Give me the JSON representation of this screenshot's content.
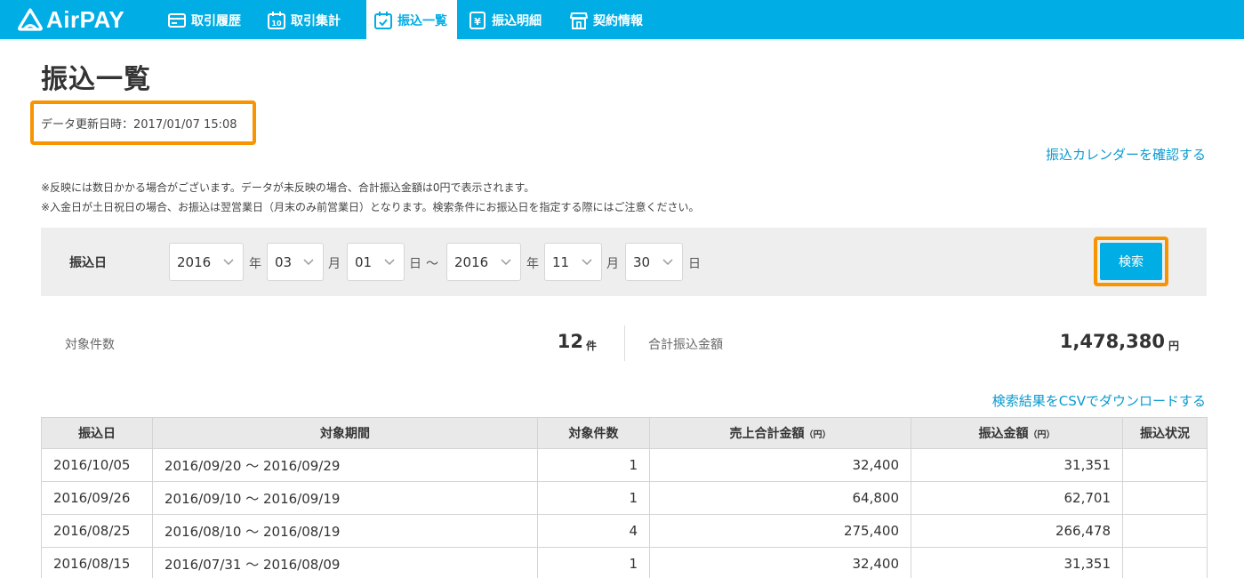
{
  "header": {
    "logo_text": "AirPAY",
    "nav": [
      {
        "label": "取引履歴",
        "icon": "card-icon",
        "active": false
      },
      {
        "label": "取引集計",
        "icon": "calendar-10-icon",
        "active": false
      },
      {
        "label": "振込一覧",
        "icon": "calendar-check-icon",
        "active": true
      },
      {
        "label": "振込明細",
        "icon": "yen-document-icon",
        "active": false
      },
      {
        "label": "契約情報",
        "icon": "shop-icon",
        "active": false
      }
    ],
    "bg_color": "#00aee5"
  },
  "page": {
    "title": "振込一覧",
    "updated": "データ更新日時：2017/01/07 15:08",
    "calendar_link": "振込カレンダーを確認する",
    "note1": "※反映には数日かかる場合がございます。データが未反映の場合、合計振込金額は0円で表示されます。",
    "note2": "※入金日が土日祝日の場合、お振込は翌営業日（月末のみ前営業日）となります。検索条件にお振込日を指定する際にはご注意ください。"
  },
  "search": {
    "label": "振込日",
    "from_year": "2016",
    "from_month": "03",
    "from_day": "01",
    "to_year": "2016",
    "to_month": "11",
    "to_day": "30",
    "unit_year": "年",
    "unit_month": "月",
    "unit_day": "日",
    "tilde": "～",
    "button": "検索",
    "highlight_color": "#f79400"
  },
  "summary": {
    "count_label": "対象件数",
    "count_value": "12",
    "count_unit": "件",
    "total_label": "合計振込金額",
    "total_value": "1,478,380",
    "total_unit": "円"
  },
  "csv_link": "検索結果をCSVでダウンロードする",
  "table": {
    "headers": [
      "振込日",
      "対象期間",
      "対象件数",
      "売上合計金額",
      "振込金額",
      "振込状況"
    ],
    "yen_suffix": "（円）",
    "rows": [
      {
        "date": "2016/10/05",
        "period": "2016/09/20 ～ 2016/09/29",
        "count": "1",
        "sales": "32,400",
        "transfer": "31,351",
        "status": ""
      },
      {
        "date": "2016/09/26",
        "period": "2016/09/10 ～ 2016/09/19",
        "count": "1",
        "sales": "64,800",
        "transfer": "62,701",
        "status": ""
      },
      {
        "date": "2016/08/25",
        "period": "2016/08/10 ～ 2016/08/19",
        "count": "4",
        "sales": "275,400",
        "transfer": "266,478",
        "status": ""
      },
      {
        "date": "2016/08/15",
        "period": "2016/07/31 ～ 2016/08/09",
        "count": "1",
        "sales": "32,400",
        "transfer": "31,351",
        "status": ""
      }
    ]
  }
}
